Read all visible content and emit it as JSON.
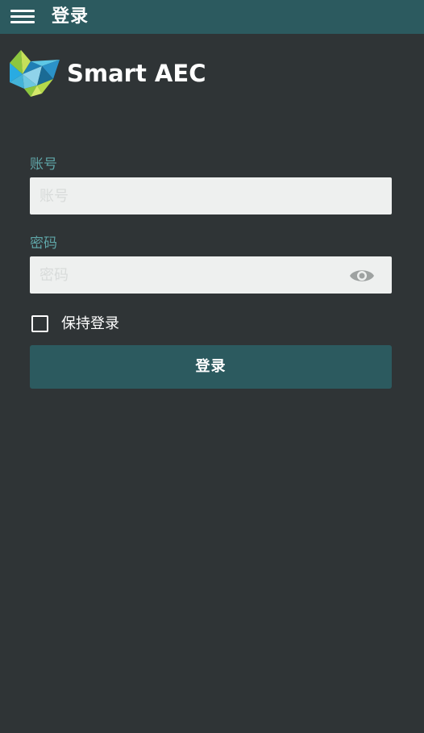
{
  "app_bar": {
    "title": "登录",
    "menu_icon": "hamburger-menu-icon",
    "background": "#2c5a5f"
  },
  "brand": {
    "logo_icon": "smart-aec-logo-icon",
    "name": "Smart AEC"
  },
  "form": {
    "account": {
      "label": "账号",
      "placeholder": "账号",
      "value": ""
    },
    "password": {
      "label": "密码",
      "placeholder": "密码",
      "value": "",
      "toggle_icon": "eye-icon"
    },
    "keep_login": {
      "label": "保持登录",
      "checked": false
    },
    "submit_label": "登录"
  },
  "colors": {
    "background": "#2f3436",
    "accent": "#2c5a5f",
    "label": "#5fa5a7",
    "input_bg": "#eef0ef"
  }
}
